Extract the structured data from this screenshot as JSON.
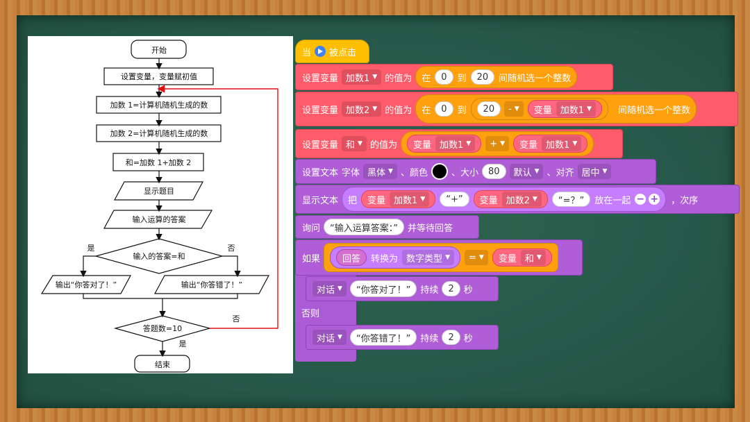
{
  "flowchart": {
    "start": "开始",
    "init": "设置变量，变量赋初值",
    "add1": "加数 1=计算机随机生成的数",
    "add2": "加数 2=计算机随机生成的数",
    "sum": "和=加数 1+加数 2",
    "show": "显示题目",
    "input": "输入运算的答案",
    "decision": "输入的答案=和",
    "yes": "是",
    "no": "否",
    "out_right": "输出“你答对了！”",
    "out_wrong": "输出“你答错了！”",
    "count": "答题数=10",
    "count_no": "否",
    "count_yes": "是",
    "end": "结束"
  },
  "blocks": {
    "hat": {
      "when": "当",
      "clicked": "被点击"
    },
    "set1": {
      "label": "设置变量",
      "var": "加数1",
      "value_of": "的值为",
      "in": "在",
      "from": "0",
      "to": "到",
      "max": "20",
      "pick": "间随机选一个整数"
    },
    "set2": {
      "label": "设置变量",
      "var": "加数2",
      "value_of": "的值为",
      "in": "在",
      "from": "0",
      "to": "到",
      "max": "20",
      "minus": "-",
      "varword": "变量",
      "varname": "加数1",
      "pick": "间随机选一个整数"
    },
    "set3": {
      "label": "设置变量",
      "var": "和",
      "value_of": "的值为",
      "varword": "变量",
      "varname1": "加数1",
      "plus": "+",
      "varname2": "加数1"
    },
    "font": {
      "label": "设置文本",
      "font": "字体",
      "fontval": "黑体",
      "color": "、颜色",
      "size": "、大小",
      "sizeval": "80",
      "default": "默认",
      "align": "、对齐",
      "alignval": "居中"
    },
    "show": {
      "label": "显示文本",
      "ba": "把",
      "varword": "变量",
      "v1": "加数1",
      "plus": "“+”",
      "v2": "加数2",
      "eq": "“=？”",
      "join": "放在一起",
      "order": "，次序"
    },
    "ask": {
      "label": "询问",
      "prompt": "“输入运算答案：”",
      "wait": "并等待回答"
    },
    "if": {
      "label": "如果",
      "answer": "回答",
      "convert": "转换为",
      "type": "数字类型",
      "eq": "=",
      "varword": "变量",
      "varname": "和"
    },
    "say1": {
      "label": "对话",
      "text": "“你答对了！”",
      "last": "持续",
      "secs": "2",
      "unit": "秒"
    },
    "else": "否则",
    "say2": {
      "label": "对话",
      "text": "“你答错了！”",
      "last": "持续",
      "secs": "2",
      "unit": "秒"
    }
  }
}
